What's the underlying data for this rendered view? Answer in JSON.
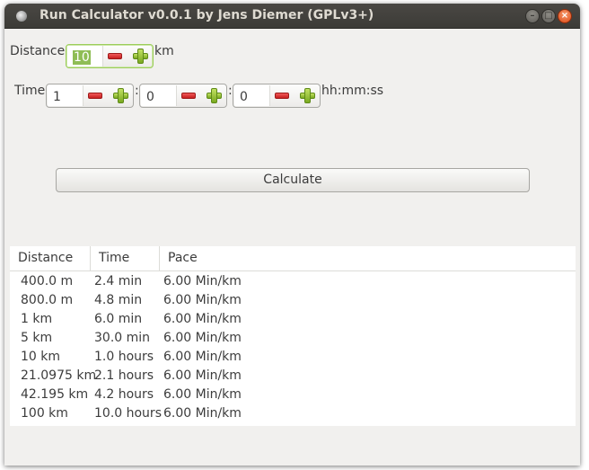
{
  "window": {
    "title": "Run Calculator v0.0.1 by Jens Diemer (GPLv3+)"
  },
  "distance": {
    "label": "Distance",
    "value": "10",
    "unit": "km"
  },
  "time": {
    "label": "Time",
    "hours": "1",
    "minutes": "0",
    "seconds": "0",
    "separator": ":",
    "format": "hh:mm:ss"
  },
  "calculate_label": "Calculate",
  "table": {
    "columns": [
      "Distance",
      "Time",
      "Pace"
    ],
    "rows": [
      {
        "distance": "400.0 m",
        "time": "2.4 min",
        "pace": "6.00 Min/km"
      },
      {
        "distance": "800.0 m",
        "time": "4.8 min",
        "pace": "6.00 Min/km"
      },
      {
        "distance": "1 km",
        "time": "6.0 min",
        "pace": "6.00 Min/km"
      },
      {
        "distance": "5 km",
        "time": "30.0 min",
        "pace": "6.00 Min/km"
      },
      {
        "distance": "10 km",
        "time": "1.0 hours",
        "pace": "6.00 Min/km"
      },
      {
        "distance": "21.0975 km",
        "time": "2.1 hours",
        "pace": "6.00 Min/km"
      },
      {
        "distance": "42.195 km",
        "time": "4.2 hours",
        "pace": "6.00 Min/km"
      },
      {
        "distance": "100 km",
        "time": "10.0 hours",
        "pace": "6.00 Min/km"
      }
    ]
  }
}
